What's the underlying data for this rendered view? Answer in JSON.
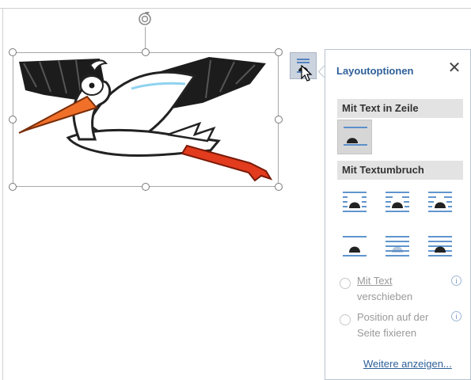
{
  "panel": {
    "title": "Layoutoptionen",
    "close_glyph": "✕",
    "section_inline": "Mit Text in Zeile",
    "section_wrap": "Mit Textumbruch",
    "radio_move_line1": "Mit Text",
    "radio_move_line2": "verschieben",
    "radio_fix_line1": "Position auf der",
    "radio_fix_line2": "Seite fixieren",
    "info_glyph": "i",
    "more_link": "Weitere anzeigen..."
  },
  "icons": {
    "rotate": "rotate-handle-icon",
    "layout_options": "layout-options-icon",
    "cursor": "mouse-pointer-icon",
    "close": "close-icon",
    "inline": "wrap-inline-icon",
    "square": "wrap-square-icon",
    "tight": "wrap-tight-icon",
    "through": "wrap-through-icon",
    "top_bottom": "wrap-top-bottom-icon",
    "behind": "wrap-behind-text-icon",
    "front": "wrap-in-front-of-text-icon",
    "info": "info-icon"
  },
  "colors": {
    "accent_blue": "#2e5f99",
    "icon_blue": "#4a86c8",
    "selected_bg": "#d6d6d6",
    "section_bg": "#e3e3e3",
    "beak_orange": "#f0702a"
  }
}
